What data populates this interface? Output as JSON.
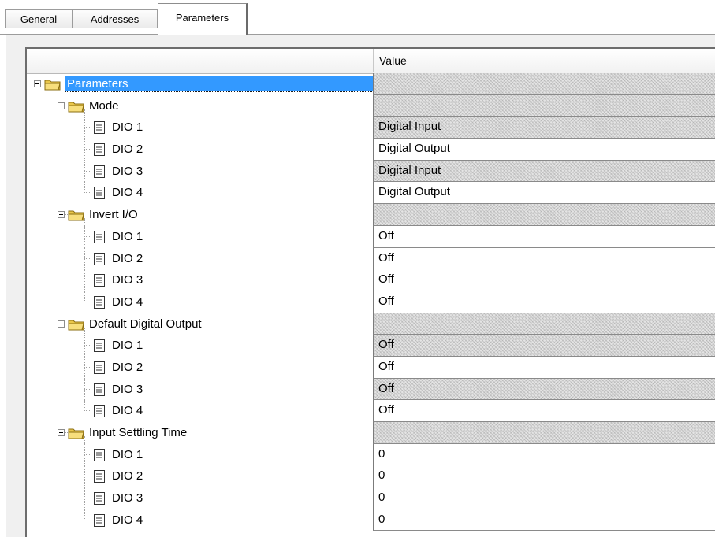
{
  "tabs": [
    {
      "label": "General"
    },
    {
      "label": "Addresses"
    },
    {
      "label": "Parameters",
      "active": true
    }
  ],
  "grid": {
    "header": {
      "name_col": "",
      "value_col": "Value"
    },
    "rows": [
      {
        "label": "Parameters",
        "level": 0,
        "type": "folder",
        "value": "",
        "readonly": true,
        "selected": true
      },
      {
        "label": "Mode",
        "level": 1,
        "type": "folder",
        "value": "",
        "readonly": true
      },
      {
        "label": "DIO 1",
        "level": 2,
        "type": "param",
        "value": "Digital Input",
        "readonly": true
      },
      {
        "label": "DIO 2",
        "level": 2,
        "type": "param",
        "value": "Digital Output",
        "readonly": false
      },
      {
        "label": "DIO 3",
        "level": 2,
        "type": "param",
        "value": "Digital Input",
        "readonly": true
      },
      {
        "label": "DIO 4",
        "level": 2,
        "type": "param",
        "value": "Digital Output",
        "readonly": false,
        "last": true
      },
      {
        "label": "Invert I/O",
        "level": 1,
        "type": "folder",
        "value": "",
        "readonly": true
      },
      {
        "label": "DIO 1",
        "level": 2,
        "type": "param",
        "value": "Off",
        "readonly": false
      },
      {
        "label": "DIO 2",
        "level": 2,
        "type": "param",
        "value": "Off",
        "readonly": false
      },
      {
        "label": "DIO 3",
        "level": 2,
        "type": "param",
        "value": "Off",
        "readonly": false
      },
      {
        "label": "DIO 4",
        "level": 2,
        "type": "param",
        "value": "Off",
        "readonly": false,
        "last": true
      },
      {
        "label": "Default Digital Output",
        "level": 1,
        "type": "folder",
        "value": "",
        "readonly": true
      },
      {
        "label": "DIO 1",
        "level": 2,
        "type": "param",
        "value": "Off",
        "readonly": true
      },
      {
        "label": "DIO 2",
        "level": 2,
        "type": "param",
        "value": "Off",
        "readonly": false
      },
      {
        "label": "DIO 3",
        "level": 2,
        "type": "param",
        "value": "Off",
        "readonly": true
      },
      {
        "label": "DIO 4",
        "level": 2,
        "type": "param",
        "value": "Off",
        "readonly": false,
        "last": true
      },
      {
        "label": "Input Settling Time",
        "level": 1,
        "type": "folder",
        "value": "",
        "readonly": true,
        "last": true
      },
      {
        "label": "DIO 1",
        "level": 2,
        "type": "param",
        "value": "0",
        "readonly": false
      },
      {
        "label": "DIO 2",
        "level": 2,
        "type": "param",
        "value": "0",
        "readonly": false
      },
      {
        "label": "DIO 3",
        "level": 2,
        "type": "param",
        "value": "0",
        "readonly": false
      },
      {
        "label": "DIO 4",
        "level": 2,
        "type": "param",
        "value": "0",
        "readonly": false,
        "last": true
      }
    ]
  },
  "icons": {
    "folder": "folder-icon",
    "param": "parameter-icon",
    "expander": "collapse-icon"
  },
  "colors": {
    "selection": "#3399ff",
    "readonly_hatch": "#e4e4e4",
    "panel": "#f0f0f0"
  }
}
